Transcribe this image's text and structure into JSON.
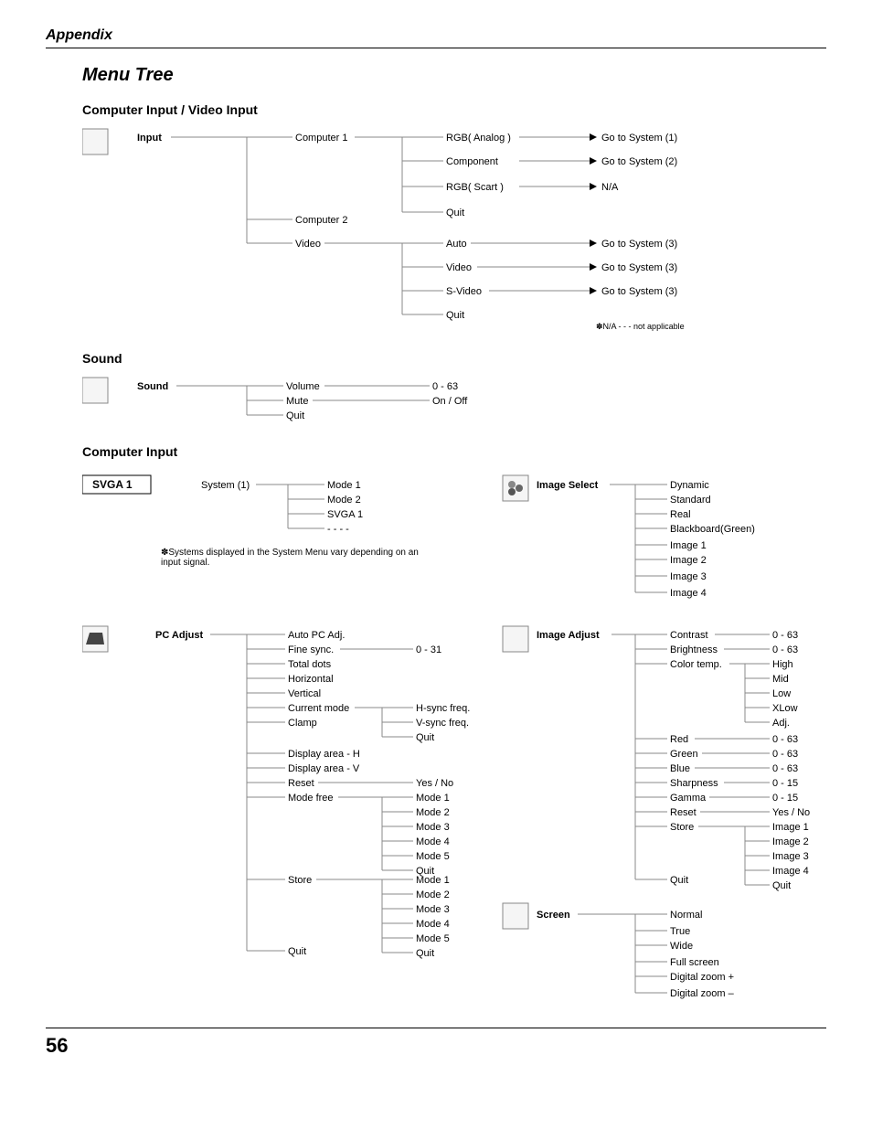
{
  "header": {
    "appendix": "Appendix",
    "title": "Menu Tree",
    "page_number": "56"
  },
  "sections": {
    "s1": "Computer Input / Video Input",
    "s2": "Sound",
    "s3": "Computer Input"
  },
  "labels": {
    "input": "Input",
    "computer1": "Computer 1",
    "computer2": "Computer 2",
    "video": "Video",
    "rgb_analog": "RGB( Analog )",
    "component": "Component",
    "rgb_scart": "RGB( Scart )",
    "quit": "Quit",
    "auto": "Auto",
    "svideo": "S-Video",
    "goto_system": "Go to ",
    "system": "System",
    "na": "N/A",
    "na_note": "✽N/A - - - not applicable",
    "sound": "Sound",
    "volume": "Volume",
    "mute": "Mute",
    "r_0_63": "0 - 63",
    "on_off": "On / Off",
    "system_menu": "System",
    "mode1": "Mode 1",
    "mode2": "Mode 2",
    "mode3": "Mode 3",
    "mode4": "Mode 4",
    "mode5": "Mode 5",
    "svga1": "SVGA 1",
    "dashes": "- - - -",
    "system_note": "✽Systems displayed in the System Menu vary depending on an input signal.",
    "image_select": "Image Select",
    "dynamic": "Dynamic",
    "standard": "Standard",
    "real": "Real",
    "blackboard": "Blackboard(Green)",
    "image1": "Image 1",
    "image2": "Image 2",
    "image3": "Image 3",
    "image4": "Image 4",
    "pc_adjust": "PC Adjust",
    "auto_pc": "Auto PC Adj.",
    "fine_sync": "Fine sync.",
    "total_dots": "Total dots",
    "horizontal": "Horizontal",
    "vertical": "Vertical",
    "current_mode": "Current mode",
    "clamp": "Clamp",
    "display_h": "Display area - H",
    "display_v": "Display area - V",
    "reset": "Reset",
    "mode_free": "Mode free",
    "store": "Store",
    "r_0_31": "0 - 31",
    "hsync": "H-sync freq.",
    "vsync": "V-sync freq.",
    "yes_no": "Yes / No",
    "image_adjust": "Image Adjust",
    "contrast": "Contrast",
    "brightness": "Brightness",
    "color_temp": "Color temp.",
    "high": "High",
    "mid": "Mid",
    "low": "Low",
    "xlow": "XLow",
    "adj": "Adj.",
    "red": "Red",
    "green": "Green",
    "blue": "Blue",
    "sharpness": "Sharpness",
    "gamma": "Gamma",
    "r_0_15": "0 - 15",
    "screen": "Screen",
    "normal": "Normal",
    "true": "True",
    "wide": "Wide",
    "full_screen": "Full screen",
    "dzoom_p": "Digital zoom +",
    "dzoom_m": "Digital zoom –",
    "sub1": "(1)",
    "sub2": "(2)",
    "sub3": "(3)",
    "svga_badge": "SVGA 1"
  }
}
